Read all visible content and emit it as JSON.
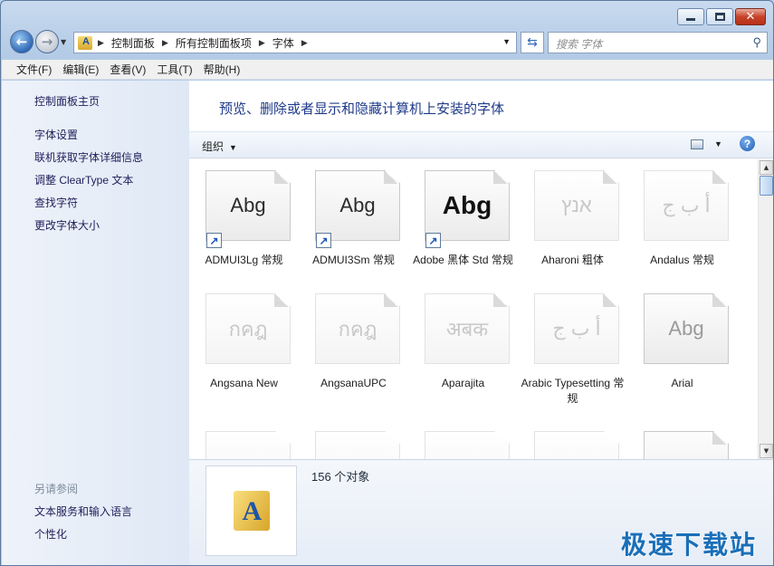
{
  "window": {
    "minimize_icon": "minimize-icon",
    "maximize_icon": "maximize-icon",
    "close_icon": "close-icon"
  },
  "nav": {
    "breadcrumbs": [
      "控制面板",
      "所有控制面板项",
      "字体"
    ],
    "search_placeholder": "搜索 字体"
  },
  "menu": [
    "文件(F)",
    "编辑(E)",
    "查看(V)",
    "工具(T)",
    "帮助(H)"
  ],
  "sidebar": {
    "home": "控制面板主页",
    "links": [
      "字体设置",
      "联机获取字体详细信息",
      "调整 ClearType 文本",
      "查找字符",
      "更改字体大小"
    ],
    "see_also": "另请参阅",
    "see_links": [
      "文本服务和输入语言",
      "个性化"
    ]
  },
  "main": {
    "heading": "预览、删除或者显示和隐藏计算机上安装的字体",
    "organize": "组织"
  },
  "fonts": [
    {
      "preview": "Abg",
      "name": "ADMUI3Lg 常规"
    },
    {
      "preview": "Abg",
      "name": "ADMUI3Sm 常规"
    },
    {
      "preview": "Abg",
      "name": "Adobe 黑体 Std 常规"
    },
    {
      "preview": "אנץ",
      "name": "Aharoni 粗体"
    },
    {
      "preview": "أ ب ج",
      "name": "Andalus 常规"
    },
    {
      "preview": "กคฎ",
      "name": "Angsana New"
    },
    {
      "preview": "กคฎ",
      "name": "AngsanaUPC"
    },
    {
      "preview": "अबक",
      "name": "Aparajita"
    },
    {
      "preview": "أ ب ج",
      "name": "Arabic Typesetting 常规"
    },
    {
      "preview": "Abg",
      "name": "Arial"
    }
  ],
  "details": {
    "count": "156 个对象"
  },
  "watermark": "极速下载站"
}
